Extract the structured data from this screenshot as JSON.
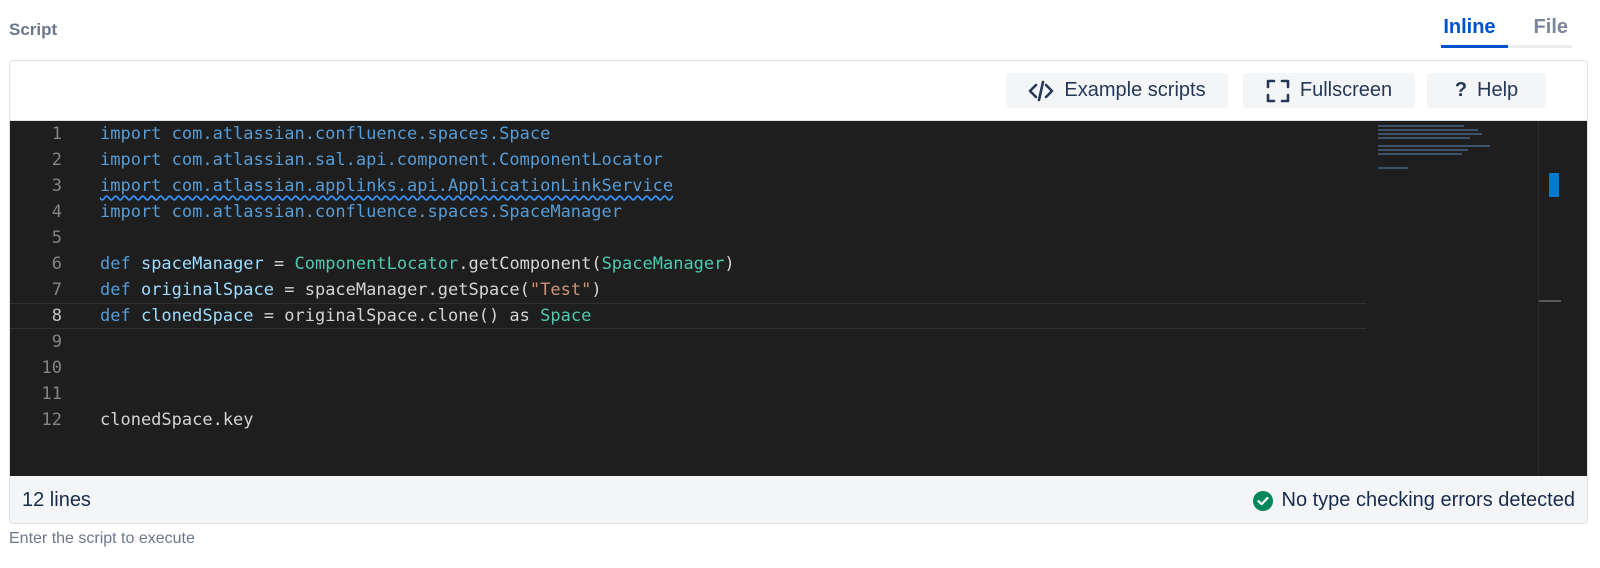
{
  "field": {
    "label": "Script",
    "helper_text": "Enter the script to execute"
  },
  "mode_tabs": [
    {
      "label": "Inline",
      "selected": true
    },
    {
      "label": "File",
      "selected": false
    }
  ],
  "toolbar": {
    "examples_label": "Example scripts",
    "fullscreen_label": "Fullscreen",
    "help_label": "Help",
    "help_glyph": "?"
  },
  "code_lines": [
    {
      "number": "1",
      "tokens": [
        {
          "t": "kw",
          "v": "import com.atlassian.confluence.spaces.Space"
        }
      ]
    },
    {
      "number": "2",
      "tokens": [
        {
          "t": "kw",
          "v": "import com.atlassian.sal.api.component.ComponentLocator"
        }
      ]
    },
    {
      "number": "3",
      "tokens": [
        {
          "t": "kw squiggle",
          "v": "import com.atlassian.applinks.api.ApplicationLinkService"
        }
      ]
    },
    {
      "number": "4",
      "tokens": [
        {
          "t": "kw",
          "v": "import com.atlassian.confluence.spaces.SpaceManager"
        }
      ]
    },
    {
      "number": "5",
      "tokens": []
    },
    {
      "number": "6",
      "tokens": [
        {
          "t": "kw",
          "v": "def "
        },
        {
          "t": "var",
          "v": "spaceManager"
        },
        {
          "t": "fn",
          "v": " = "
        },
        {
          "t": "ty",
          "v": "ComponentLocator"
        },
        {
          "t": "fn",
          "v": ".getComponent("
        },
        {
          "t": "ty",
          "v": "SpaceManager"
        },
        {
          "t": "fn",
          "v": ")"
        }
      ]
    },
    {
      "number": "7",
      "tokens": [
        {
          "t": "kw",
          "v": "def "
        },
        {
          "t": "var",
          "v": "originalSpace"
        },
        {
          "t": "fn",
          "v": " = spaceManager.getSpace("
        },
        {
          "t": "str",
          "v": "\"Test\""
        },
        {
          "t": "fn",
          "v": ")"
        }
      ]
    },
    {
      "number": "8",
      "tokens": [
        {
          "t": "kw",
          "v": "def "
        },
        {
          "t": "var",
          "v": "clonedSpace"
        },
        {
          "t": "fn",
          "v": " = originalSpace.clone() as "
        },
        {
          "t": "ty",
          "v": "Space"
        }
      ]
    },
    {
      "number": "9",
      "tokens": []
    },
    {
      "number": "10",
      "tokens": []
    },
    {
      "number": "11",
      "tokens": []
    },
    {
      "number": "12",
      "tokens": [
        {
          "t": "fn",
          "v": "clonedSpace.key"
        }
      ]
    }
  ],
  "current_line": "8",
  "status": {
    "line_count": "12 lines",
    "message": "No type checking errors detected",
    "ok_color": "#00875a"
  },
  "icons": {
    "examples": "code-brackets-icon",
    "fullscreen": "fullscreen-icon",
    "help": "question-mark-icon",
    "status": "check-circle-icon"
  },
  "colors": {
    "accent": "#0052cc",
    "editor_bg": "#1e1e1e",
    "keyword": "#569cd6",
    "type": "#4ec9b0",
    "string": "#ce9178"
  }
}
